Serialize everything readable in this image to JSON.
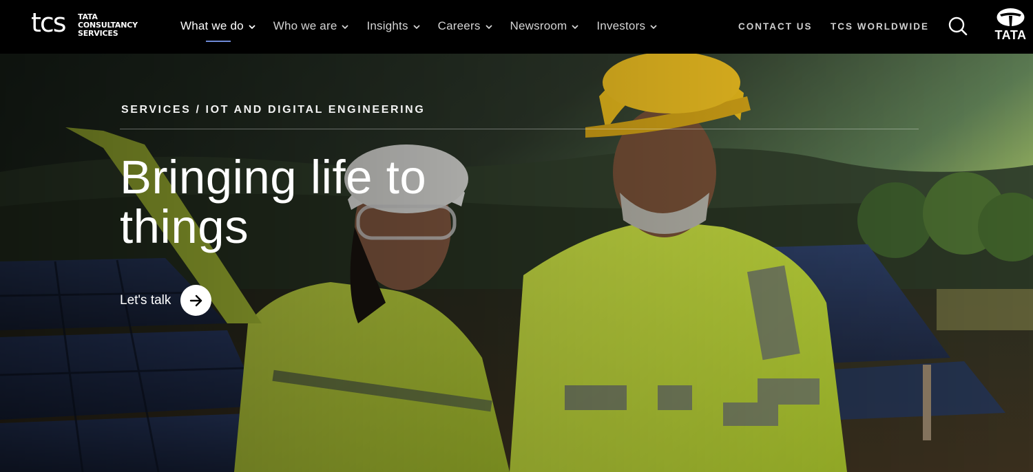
{
  "brand": {
    "logo_mark": "tcs",
    "logo_lines": [
      "TATA",
      "CONSULTANCY",
      "SERVICES"
    ],
    "parent_logo": "TATA"
  },
  "nav": {
    "items": [
      {
        "label": "What we do",
        "active": true
      },
      {
        "label": "Who we are",
        "active": false
      },
      {
        "label": "Insights",
        "active": false
      },
      {
        "label": "Careers",
        "active": false
      },
      {
        "label": "Newsroom",
        "active": false
      },
      {
        "label": "Investors",
        "active": false
      }
    ],
    "contact_label": "CONTACT US",
    "worldwide_label": "TCS WORLDWIDE",
    "search_icon": "search-icon"
  },
  "hero": {
    "breadcrumb": "SERVICES / IOT AND DIGITAL ENGINEERING",
    "headline_line1": "Bringing life to",
    "headline_line2": "things",
    "cta_label": "Let's talk",
    "cta_icon": "arrow-right-icon"
  },
  "colors": {
    "header_bg": "#000000",
    "active_underline": "#6f8bd8",
    "vest": "#c8e23a",
    "helmet": "#f2c21d"
  }
}
